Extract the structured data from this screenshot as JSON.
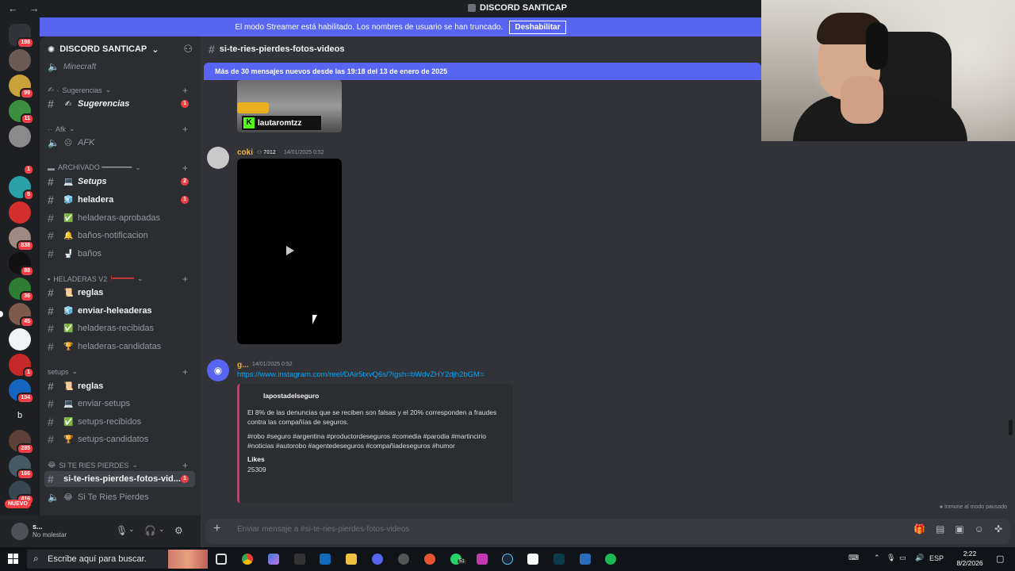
{
  "window": {
    "title": "DISCORD SANTICAP",
    "back": "←",
    "forward": "→"
  },
  "streamer_banner": {
    "text": "El modo Streamer está habilitado. Los nombres de usuario se han truncado.",
    "button": "Deshabilitar"
  },
  "server_rail": {
    "badges": [
      "198",
      "99",
      "11",
      "1",
      "5",
      "838",
      "88",
      "36",
      "45",
      "1",
      "134",
      "285",
      "166",
      "416"
    ],
    "nuevo": "NUEVO",
    "letter_server": "b"
  },
  "sidebar": {
    "guild_name": "DISCORD SANTICAP",
    "partial_channel": "Minecraft",
    "categories": {
      "sugerencias": "Sugerencias",
      "afk": "Afk",
      "archivado": "ARCHIVADO ━━━━━━━",
      "heladeras": "HELADERAS V2",
      "setups": "setups",
      "siteries": "SI TE RIES PIERDES"
    },
    "channels": {
      "sugerencias": {
        "label": "Sugerencias",
        "emoji": "✍",
        "count": "1"
      },
      "afk": {
        "label": "AFK",
        "emoji": "☹"
      },
      "setups_arch": {
        "label": "Setups",
        "emoji": "💻",
        "count": "2"
      },
      "heladera": {
        "label": "heladera",
        "emoji": "🧊",
        "count": "1"
      },
      "heladeras_aprobadas": {
        "label": "heladeras-aprobadas",
        "emoji": "✅"
      },
      "banos_notif": {
        "label": "baños-notificacion",
        "emoji": "🔔"
      },
      "banos": {
        "label": "baños",
        "emoji": "🚽"
      },
      "reglas_h": {
        "label": "reglas",
        "emoji": "📜"
      },
      "enviar_heladeras": {
        "label": "enviar-heleaderas",
        "emoji": "🧊"
      },
      "heladeras_recibidas": {
        "label": "heladeras-recibidas",
        "emoji": "✅"
      },
      "heladeras_candidatas": {
        "label": "heladeras-candidatas",
        "emoji": "🏆"
      },
      "reglas_s": {
        "label": "reglas",
        "emoji": "📜"
      },
      "enviar_setups": {
        "label": "enviar-setups",
        "emoji": "💻"
      },
      "setups_recibidos": {
        "label": "setups-recibidos",
        "emoji": "✅"
      },
      "setups_candidatos": {
        "label": "setups-candidatos",
        "emoji": "🏆"
      },
      "siteries_text": {
        "label": "si-te-ries-pierdes-fotos-vid...",
        "count": "1"
      },
      "siteries_voice": {
        "label": "Si Te Ries Pierdes",
        "emoji": "😂"
      }
    }
  },
  "user_panel": {
    "name": "s...",
    "status": "No molestar"
  },
  "channel_header": {
    "name": "si-te-ries-pierdes-fotos-videos"
  },
  "new_messages_bar": {
    "text": "Más de 30 mensajes nuevos desde las 19:18 del 13 de enero de 2025"
  },
  "messages": [
    {
      "thumb_caption": "lautaromtzz"
    },
    {
      "author": "coki",
      "tag": "7012",
      "time": "14/01/2025 0:52"
    },
    {
      "author": "g...",
      "time": "14/01/2025 0:52",
      "link": "https://www.instagram.com/reel/DAir5txvQ6s/?igsh=bWdvZHY2djh2bGM=",
      "embed": {
        "author": "lapostadelseguro",
        "description": "El 8% de las denuncias que se reciben son falsas y el 20% corresponden a fraudes contra las compañías de seguros.",
        "hashtags": "#robo #seguro #argentina #productordeseguros #comedia #parodia #martincirio #noticias #autorobo #agentedeseguros #compañiadeseguros #humor",
        "field_name": "Likes",
        "field_value": "25309"
      }
    }
  ],
  "immune_note": "Inmune al modo pausado",
  "composer": {
    "placeholder": "Enviar mensaje a #si-te-ries-pierdes-fotos-videos"
  },
  "taskbar": {
    "search_placeholder": "Escribe aquí para buscar.",
    "whatsapp_badge": "51",
    "language": "ESP",
    "time": "2:22",
    "date": "8/2/2026"
  },
  "colors": {
    "accent": "#5865f2",
    "danger": "#f23f43",
    "link": "#00a8fc",
    "instagram": "#e1306c"
  }
}
